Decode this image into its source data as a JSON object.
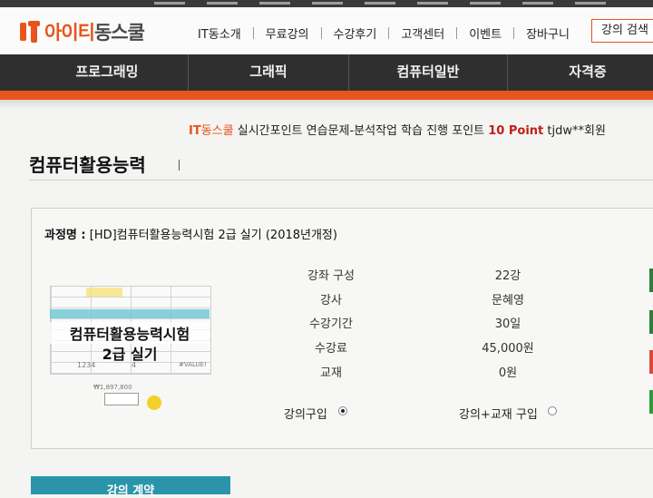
{
  "header": {
    "logo_brand": "아이티",
    "logo_rest": "동스쿨",
    "nav": [
      "IT동소개",
      "무료강의",
      "수강후기",
      "고객센터",
      "이벤트",
      "장바구니"
    ],
    "search_button": "강의 검색"
  },
  "categories": [
    "프로그래밍",
    "그래픽",
    "컴퓨터일반",
    "자격증"
  ],
  "ticker": {
    "brand_it": "IT",
    "brand_rest": "동스쿨",
    "text": " 실시간포인트 연습문제-분석작업 학습 진행 포인트 ",
    "points": "10 Point",
    "user": " tjdw**회원"
  },
  "page_title": "컴퓨터활용능력",
  "course": {
    "name_label": "과정명 :",
    "name": " [HD]컴퓨터활용능력시험 2급 실기 (2018년개정)",
    "thumbnail": {
      "line1": "컴퓨터활용능력시험",
      "line2": "2급 실기",
      "cell_a": "1234",
      "cell_b": "4",
      "cell_c": "#VALUE!",
      "mini_value": "₩1,897,800"
    },
    "info": [
      {
        "key": "강좌 구성",
        "value": "22강"
      },
      {
        "key": "강사",
        "value": "문혜영"
      },
      {
        "key": "수강기간",
        "value": "30일"
      },
      {
        "key": "수강료",
        "value": "45,000원"
      },
      {
        "key": "교재",
        "value": "0원"
      }
    ],
    "options": {
      "lecture_only": "강의구입",
      "lecture_book": "강의+교재 구입",
      "selected": "lecture_only"
    }
  },
  "cta": "강의 계약"
}
